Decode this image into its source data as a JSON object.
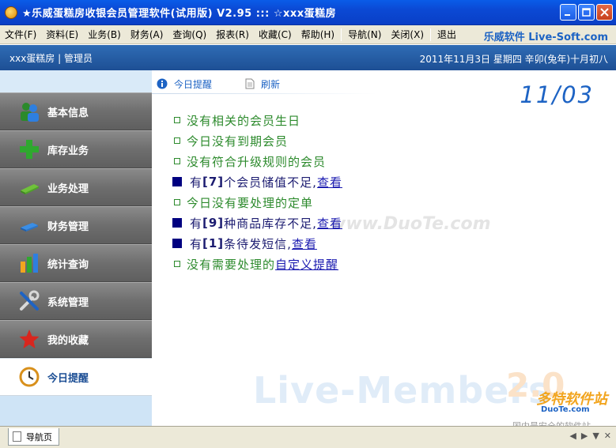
{
  "window": {
    "title": "★乐威蛋糕房收银会员管理软件(试用版) V2.95  :::  ☆xxx蛋糕房"
  },
  "menu": {
    "items": [
      "文件(F)",
      "资料(E)",
      "业务(B)",
      "财务(A)",
      "查询(Q)",
      "报表(R)",
      "收藏(C)",
      "帮助(H)"
    ],
    "nav": [
      "导航(N)",
      "关闭(X)"
    ],
    "exit": "退出",
    "brand": "乐威软件 Live-Soft.com"
  },
  "infobar": {
    "shop": "xxx蛋糕房",
    "role": "管理员",
    "date_text": "2011年11月3日  星期四  辛卯(兔年)十月初八"
  },
  "sidebar": {
    "items": [
      {
        "label": "基本信息",
        "icon": "people-icon"
      },
      {
        "label": "库存业务",
        "icon": "plus-icon"
      },
      {
        "label": "业务处理",
        "icon": "card-icon"
      },
      {
        "label": "财务管理",
        "icon": "money-icon"
      },
      {
        "label": "统计查询",
        "icon": "bar-chart-icon"
      },
      {
        "label": "系统管理",
        "icon": "tools-icon"
      },
      {
        "label": "我的收藏",
        "icon": "star-icon"
      },
      {
        "label": "今日提醒",
        "icon": "clock-icon",
        "active": true
      }
    ]
  },
  "main": {
    "toolbar": {
      "today_label": "今日提醒",
      "refresh_label": "刷新"
    },
    "date_big": "11/03",
    "reminders": [
      {
        "text": "没有相关的会员生日"
      },
      {
        "text": "今日没有到期会员"
      },
      {
        "text": "没有符合升级规则的会员"
      },
      {
        "pre": "有",
        "count": "[7]",
        "post": "个会员储值不足,",
        "link": "查看"
      },
      {
        "text": "今日没有要处理的定单"
      },
      {
        "pre": "有",
        "count": "[9]",
        "post": "种商品库存不足,",
        "link": "查看"
      },
      {
        "pre": "有",
        "count": "[1]",
        "post": "条待发短信,",
        "link": "查看"
      },
      {
        "pre": "没有需要处理的",
        "link": "自定义提醒"
      }
    ],
    "watermark": "Live-Members",
    "watermark_version": "2.0",
    "site_watermark": "www.DuoTe.com",
    "duote_logo": "多特软件站",
    "duote_sub": "DuoTe.com",
    "duote_slogan": "国内最安全的软件站"
  },
  "tabs": {
    "items": [
      "导航页"
    ]
  },
  "colors": {
    "titlebar": "#0b49d4",
    "infobar": "#2f6cb5",
    "green_text": "#2c8a2c",
    "link": "#1b1bb0",
    "accent": "#1d63c4"
  }
}
